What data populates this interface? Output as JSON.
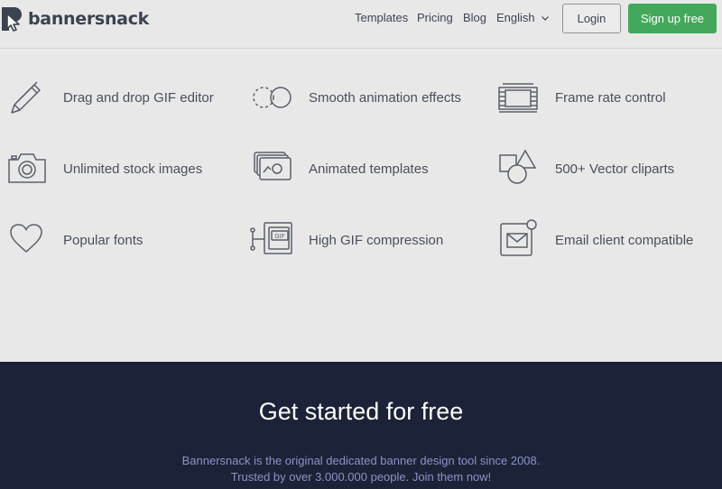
{
  "header": {
    "logo_text": "bannersnack",
    "nav": {
      "templates": "Templates",
      "pricing": "Pricing",
      "blog": "Blog",
      "language": "English"
    },
    "login_label": "Login",
    "signup_label": "Sign up free"
  },
  "features": {
    "items": [
      {
        "label": "Drag and drop GIF editor",
        "icon": "pencil-icon"
      },
      {
        "label": "Smooth animation effects",
        "icon": "animation-circles-icon"
      },
      {
        "label": "Frame rate control",
        "icon": "film-frames-icon"
      },
      {
        "label": "Unlimited stock images",
        "icon": "camera-icon"
      },
      {
        "label": "Animated templates",
        "icon": "templates-stack-icon"
      },
      {
        "label": "500+ Vector cliparts",
        "icon": "shapes-icon"
      },
      {
        "label": "Popular fonts",
        "icon": "heart-icon"
      },
      {
        "label": "High GIF compression",
        "icon": "gif-compression-icon"
      },
      {
        "label": "Email client compatible",
        "icon": "email-icon"
      }
    ]
  },
  "cta": {
    "title": "Get started for free",
    "line1": "Bannersnack is the original dedicated banner design tool since 2008.",
    "line2": "Trusted by over 3.000.000 people. Join them now!"
  },
  "colors": {
    "background": "#e8e8e8",
    "text": "#4a4f5a",
    "accent_green": "#43a85b",
    "cta_background": "#1c2338",
    "cta_desc": "#8b93c4"
  }
}
